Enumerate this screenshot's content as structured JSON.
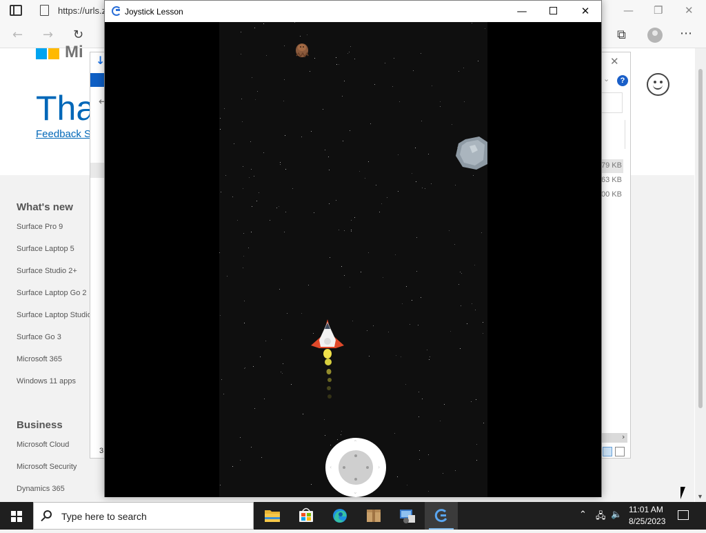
{
  "browser": {
    "url": "https://urls.zi",
    "page": {
      "brand_fragment": "Mi",
      "heading_fragment": "Thar",
      "feedback_fragment": "Feedback Si",
      "whats_new": {
        "heading": "What's new",
        "links": [
          "Surface Pro 9",
          "Surface Laptop 5",
          "Surface Studio 2+",
          "Surface Laptop Go 2",
          "Surface Laptop Studio",
          "Surface Go 3",
          "Microsoft 365",
          "Windows 11 apps"
        ]
      },
      "business": {
        "heading": "Business",
        "links": [
          "Microsoft Cloud",
          "Microsoft Security",
          "Dynamics 365"
        ]
      }
    }
  },
  "dialog": {
    "help_label": "?",
    "file_sizes": [
      "79 KB",
      "63 KB",
      "00 KB"
    ],
    "status_count": "3"
  },
  "game_window": {
    "title": "Joystick Lesson",
    "minimize_glyph": "—",
    "close_glyph": "✕"
  },
  "taskbar": {
    "search_placeholder": "Type here to search",
    "time": "11:01 AM",
    "date": "8/25/2023",
    "pinned_apps": [
      "file-explorer",
      "microsoft-store",
      "edge",
      "package-app",
      "control-panel",
      "joystick-lesson"
    ]
  },
  "colors": {
    "game_bg": "#0f0f0f",
    "ms_blue": "#0067b8",
    "ship_red": "#e0492a",
    "flame_yellow": "#e6d84a"
  }
}
